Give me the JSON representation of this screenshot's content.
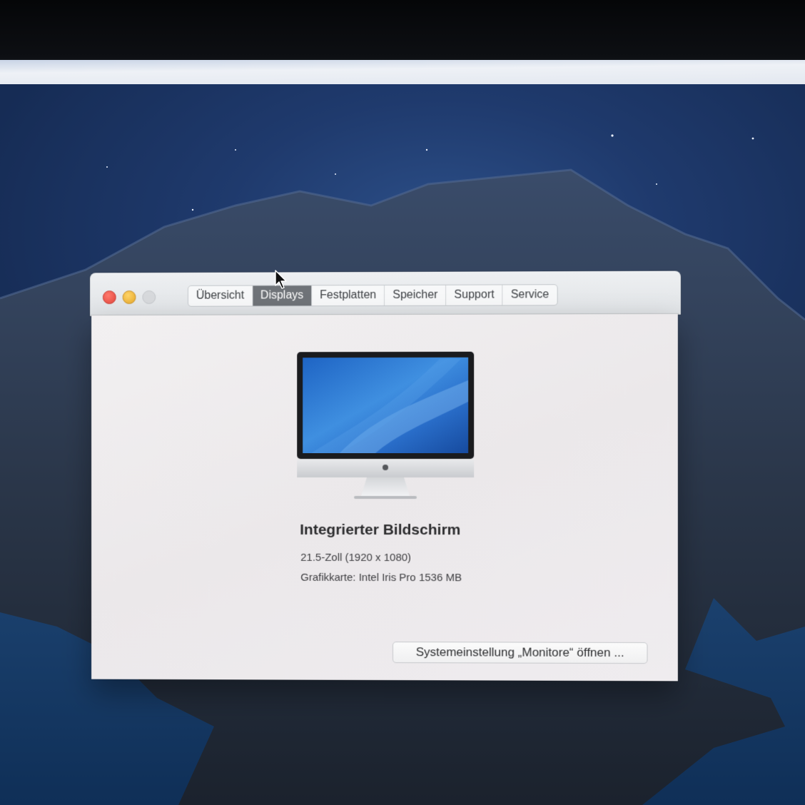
{
  "window": {
    "traffic_lights": [
      "close",
      "minimize",
      "zoom"
    ],
    "tabs": [
      {
        "label": "Übersicht",
        "active": false
      },
      {
        "label": "Displays",
        "active": true
      },
      {
        "label": "Festplatten",
        "active": false
      },
      {
        "label": "Speicher",
        "active": false
      },
      {
        "label": "Support",
        "active": false
      },
      {
        "label": "Service",
        "active": false
      }
    ]
  },
  "display": {
    "title": "Integrierter Bildschirm",
    "size_resolution": "21.5-Zoll (1920 x 1080)",
    "graphics": "Grafikkarte: Intel Iris Pro 1536 MB"
  },
  "actions": {
    "open_monitors_label": "Systemeinstellung „Monitore“ öffnen ..."
  },
  "icons": {
    "computer": "imac-icon",
    "pointer": "cursor-icon"
  }
}
